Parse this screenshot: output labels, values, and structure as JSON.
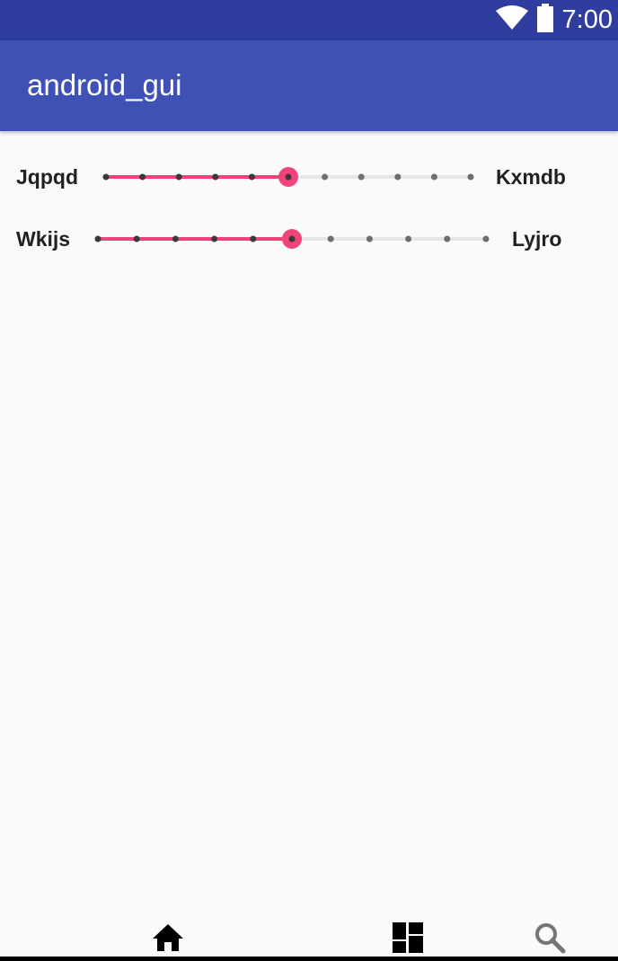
{
  "status_bar": {
    "time": "7:00",
    "icons": [
      "wifi-icon",
      "battery-icon"
    ]
  },
  "app_bar": {
    "title": "android_gui"
  },
  "sliders": [
    {
      "left_label": "Jqpqd",
      "right_label": "Kxmdb",
      "steps": 10,
      "value_step": 5
    },
    {
      "left_label": "Wkijs",
      "right_label": "Lyjro",
      "steps": 10,
      "value_step": 5
    }
  ],
  "bottom_nav": {
    "items": [
      "home-icon",
      "dashboard-icon",
      "search-icon"
    ]
  },
  "colors": {
    "status_bar": "#2f3e9e",
    "app_bar": "#3f51b5",
    "accent": "#f0437a",
    "background": "#fafafa"
  }
}
